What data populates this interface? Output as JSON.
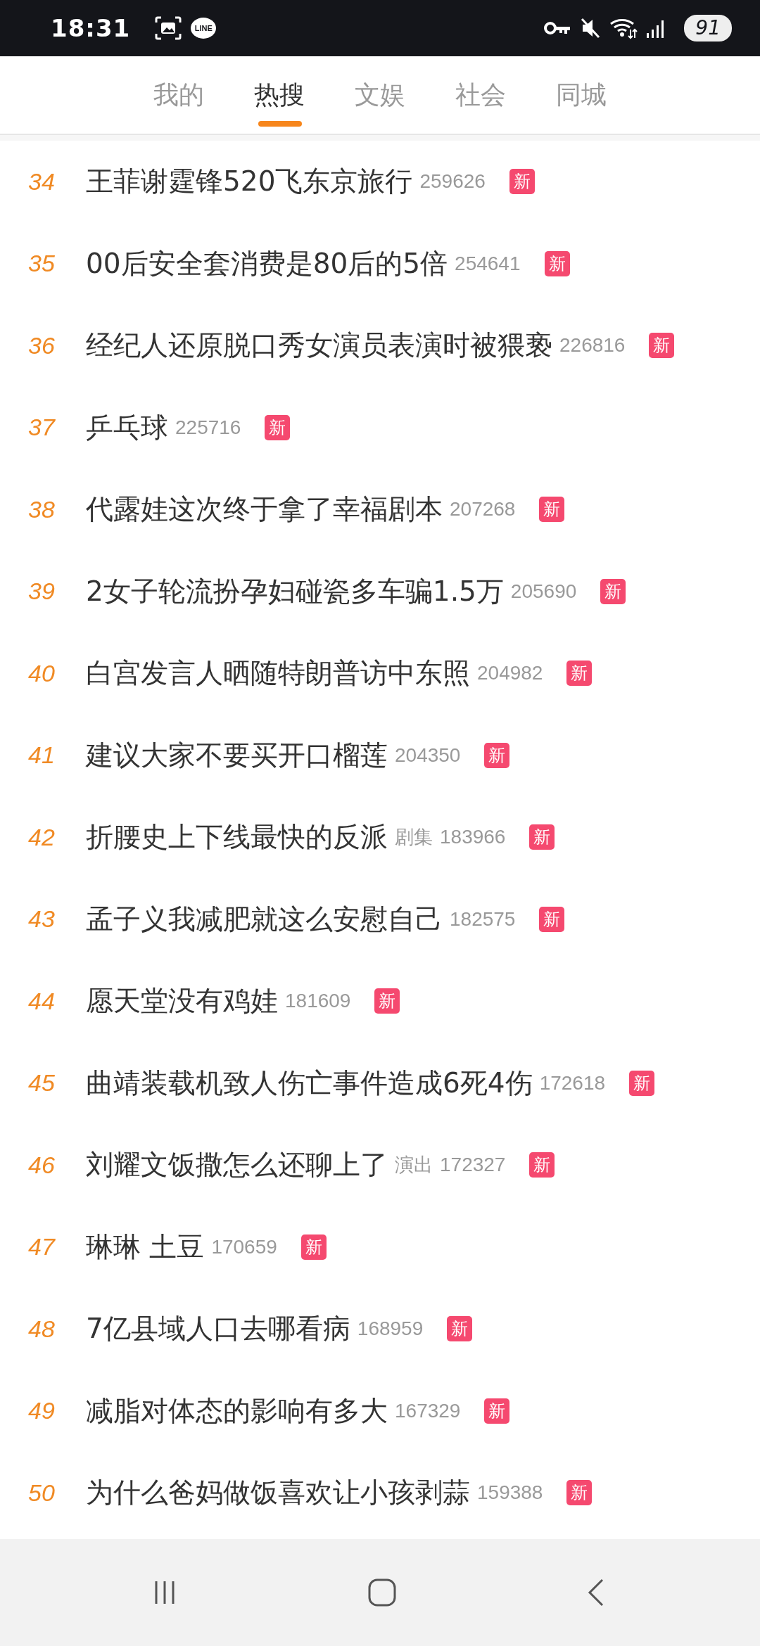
{
  "status_bar": {
    "time": "18:31",
    "app_label": "LINE",
    "battery": "91"
  },
  "tabs": [
    {
      "label": "我的",
      "selected": false
    },
    {
      "label": "热搜",
      "selected": true
    },
    {
      "label": "文娱",
      "selected": false
    },
    {
      "label": "社会",
      "selected": false
    },
    {
      "label": "同城",
      "selected": false
    }
  ],
  "items": [
    {
      "rank": "34",
      "title": "王菲谢霆锋520飞东京旅行",
      "count": "259626",
      "badge": "新"
    },
    {
      "rank": "35",
      "title": "00后安全套消费是80后的5倍",
      "count": "254641",
      "badge": "新"
    },
    {
      "rank": "36",
      "title": "经纪人还原脱口秀女演员表演时被猥亵",
      "count": "226816",
      "badge": "新"
    },
    {
      "rank": "37",
      "title": "乒乓球",
      "count": "225716",
      "badge": "新"
    },
    {
      "rank": "38",
      "title": "代露娃这次终于拿了幸福剧本",
      "count": "207268",
      "badge": "新"
    },
    {
      "rank": "39",
      "title": "2女子轮流扮孕妇碰瓷多车骗1.5万",
      "count": "205690",
      "badge": "新"
    },
    {
      "rank": "40",
      "title": "白宫发言人晒随特朗普访中东照",
      "count": "204982",
      "badge": "新"
    },
    {
      "rank": "41",
      "title": "建议大家不要买开口榴莲",
      "count": "204350",
      "badge": "新"
    },
    {
      "rank": "42",
      "title": "折腰史上下线最快的反派",
      "category": "剧集",
      "count": "183966",
      "badge": "新"
    },
    {
      "rank": "43",
      "title": "孟子义我减肥就这么安慰自己",
      "count": "182575",
      "badge": "新"
    },
    {
      "rank": "44",
      "title": "愿天堂没有鸡娃",
      "count": "181609",
      "badge": "新"
    },
    {
      "rank": "45",
      "title": "曲靖装载机致人伤亡事件造成6死4伤",
      "count": "172618",
      "badge": "新"
    },
    {
      "rank": "46",
      "title": "刘耀文饭撒怎么还聊上了",
      "category": "演出",
      "count": "172327",
      "badge": "新"
    },
    {
      "rank": "47",
      "title": "琳琳 土豆",
      "count": "170659",
      "badge": "新"
    },
    {
      "rank": "48",
      "title": "7亿县域人口去哪看病",
      "count": "168959",
      "badge": "新"
    },
    {
      "rank": "49",
      "title": "减脂对体态的影响有多大",
      "count": "167329",
      "badge": "新"
    },
    {
      "rank": "50",
      "title": "为什么爸妈做饭喜欢让小孩剥蒜",
      "count": "159388",
      "badge": "新"
    }
  ]
}
